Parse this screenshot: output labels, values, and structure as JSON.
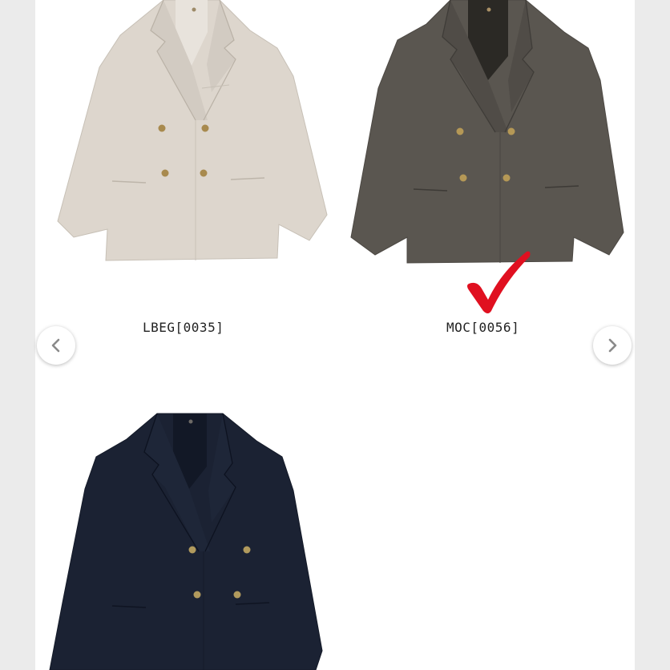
{
  "products": [
    {
      "label": "LBEG[0035]",
      "color": "#ddd6cd",
      "selected": false
    },
    {
      "label": "MOC[0056]",
      "color": "#5a5650",
      "selected": true
    },
    {
      "label": "",
      "color": "#1b2233",
      "selected": false
    }
  ],
  "selection_mark": {
    "icon": "checkmark-icon",
    "color": "#e01020"
  },
  "carousel": {
    "prev_icon": "chevron-left-icon",
    "next_icon": "chevron-right-icon"
  }
}
